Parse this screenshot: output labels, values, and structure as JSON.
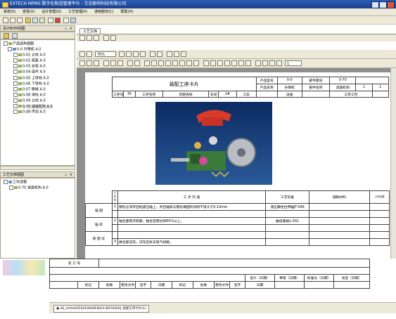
{
  "window": {
    "title": "EXTECH MPMS 数字化制造管理平台 - 艾克斯特科技有限公司"
  },
  "menu": [
    "系统(S)",
    "查看(V)",
    "设计管理(D)",
    "工艺管理(P)",
    "通用服务(C)",
    "帮助(H)"
  ],
  "left_top": {
    "title": "设计BOM视图",
    "tree_root": "产品结构视图",
    "tree_top": "0-0 升降机 A.0",
    "tree_items": [
      "0-01 立柱 A.0",
      "0-02 底座 A.0",
      "0-03 支架 A.0",
      "0-04 连杆 A.0",
      "0-05 上导柱 A.0",
      "0-06 下导柱 A.0",
      "0-07 联接 A.0",
      "0-08 滑柱 A.0",
      "0-09 立柱 A.0",
      "0-70 减速机构 A.0",
      "0-08 传动 A.0"
    ]
  },
  "left_bottom": {
    "title": "工艺文档视图",
    "tree_root": "工作流程",
    "tree_item": "0-70 减速机构 A.0"
  },
  "doc_tab": "工艺文档",
  "zoom": "75%",
  "page_box": "1",
  "card": {
    "title": "装配工序卡片",
    "product_model_label": "产品型号",
    "product_model": "0-0",
    "part_no_label": "部件图号",
    "part_no": "0-70",
    "product_name_label": "产品名称",
    "product_name": "升降机",
    "part_name_label": "部件名称",
    "part_name": "减速机构",
    "total_pages": "1",
    "page_no": "1",
    "proc_no_label": "工序号",
    "proc_no": "35",
    "proc_name_label": "工序名称",
    "proc_name": "装配壳体",
    "workshop_label": "车间",
    "workshop": "2#",
    "section_label": "工段",
    "equipment_label": "设备",
    "work_hours_label": "工序工时",
    "col_step": "工步号",
    "col_content": "工 步 内 容",
    "col_equipment": "工艺装备",
    "col_aux": "辅助材料",
    "col_hours": "工时定额",
    "side_labels": [
      "描 图",
      "描 校",
      "底 图 号",
      "装 订 号"
    ],
    "steps": [
      {
        "no": "1",
        "content": "键轮必须牢固地紧压轴上，并且轴肩与键轮端面的间隙不得大于0.10mm",
        "equipment": "液压螺栓拉伸器JT-089"
      },
      {
        "no": "2",
        "content": "轴合面需求研磨，轴合度需达到85%以上。",
        "equipment": "触度塞规L-001"
      },
      {
        "no": "3",
        "content": "",
        "equipment": ""
      },
      {
        "no": "3",
        "content": "做合部试装。试车后拆去电气线路。",
        "equipment": ""
      }
    ],
    "footer_labels": [
      "设计（日期）",
      "审核（日期）",
      "标准化（日期）",
      "会签（日期）"
    ],
    "sign_labels": [
      "标记",
      "处数",
      "更改文件号",
      "签字",
      "日期",
      "标记",
      "处数",
      "更改文件号",
      "签字",
      "日期"
    ]
  },
  "status_tab": "4S_AAAA03F04100A9F80213DF00400_装配工序卡片(1)",
  "colors": {
    "title_bar": "#1b3f8c",
    "chrome": "#ece9d8",
    "doc_bg": "#8e8e8e"
  }
}
